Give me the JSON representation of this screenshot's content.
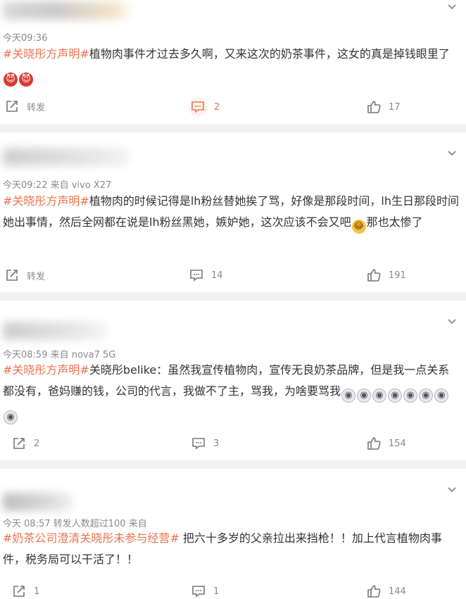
{
  "posts": [
    {
      "time": "今天09:36",
      "hashtag": "#关晓彤方声明#",
      "text": "植物肉事件才过去多久啊，又来这次的奶茶事件，这女的真是掉钱眼里了",
      "emoji_after": [
        "devil-emoji",
        "devil-emoji"
      ],
      "repost_label": "转发",
      "comments": "2",
      "likes": "17"
    },
    {
      "time": "今天09:22 来自 vivo X27",
      "hashtag": "#关晓彤方声明#",
      "text_a": "植物肉的时候记得是lh粉丝替她挨了骂，好像是那段时间，lh生日那段时间她出事情，然后全网都在说是lh粉丝黑她，嫉妒她，这次应该不会又吧",
      "text_b": "那也太惨了",
      "repost_label": "转发",
      "comments": "14",
      "likes": "191"
    },
    {
      "time": "今天08:59 来自 nova7 5G",
      "hashtag": "#关晓彤方声明#",
      "text": "关晓彤belike：虽然我宣传植物肉，宣传无良奶茶品牌，但是我一点关系都没有，爸妈赚的钱，公司的代言，我做不了主，骂我，为啥要骂我",
      "reposts": "2",
      "comments": "3",
      "likes": "154"
    },
    {
      "time": "今天 08:57 转发人数超过100 来自",
      "hashtag": "#奶茶公司澄清关晓彤未参与经营#",
      "text": " 把六十多岁的父亲拉出来挡枪！！加上代言植物肉事件，税务局可以干活了！！",
      "reposts": "1",
      "comments": "1",
      "likes": "144"
    }
  ],
  "colors": {
    "accent": "#eb7350",
    "text": "#333333",
    "meta": "#8a8a8a",
    "separator": "#f2f2f2"
  },
  "icons": [
    "chevron-down-icon",
    "repost-icon",
    "comment-icon",
    "like-icon"
  ]
}
